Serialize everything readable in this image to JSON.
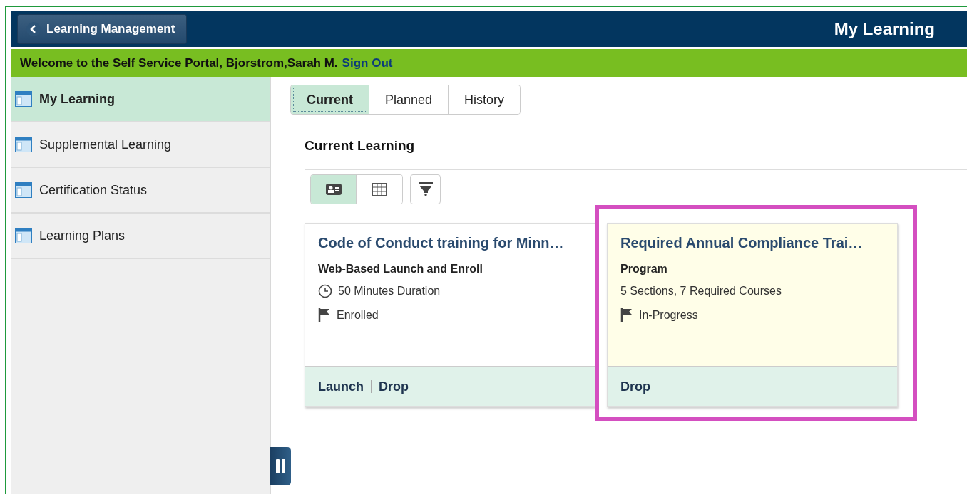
{
  "header": {
    "back_button": "Learning Management",
    "title": "My Learning"
  },
  "welcome": {
    "text": "Welcome to the Self Service Portal, Bjorstrom,Sarah M.",
    "link": "Sign Out"
  },
  "sidebar": {
    "items": [
      {
        "label": "My Learning",
        "selected": true
      },
      {
        "label": "Supplemental Learning",
        "selected": false
      },
      {
        "label": "Certification Status",
        "selected": false
      },
      {
        "label": "Learning Plans",
        "selected": false
      }
    ]
  },
  "tabs": [
    {
      "label": "Current",
      "selected": true
    },
    {
      "label": "Planned",
      "selected": false
    },
    {
      "label": "History",
      "selected": false
    }
  ],
  "section_title": "Current Learning",
  "view_toggle": [
    {
      "kind": "card",
      "selected": true
    },
    {
      "kind": "grid",
      "selected": false
    }
  ],
  "cards": [
    {
      "kind": "course",
      "highlighted": false,
      "title": "Code of Conduct training for Minn…",
      "type": "Web-Based Launch and Enroll",
      "lines": [
        {
          "kind": "clock",
          "text": "50 Minutes Duration"
        },
        {
          "kind": "flag",
          "text": "Enrolled"
        }
      ],
      "actions": [
        "Launch",
        "Drop"
      ]
    },
    {
      "kind": "program",
      "highlighted": true,
      "title": "Required Annual Compliance Trai…",
      "type": "Program",
      "lines": [
        {
          "kind": "plain",
          "text": "5 Sections, 7 Required Courses"
        },
        {
          "kind": "flag",
          "text": "In-Progress"
        }
      ],
      "actions": [
        "Drop"
      ]
    }
  ]
}
